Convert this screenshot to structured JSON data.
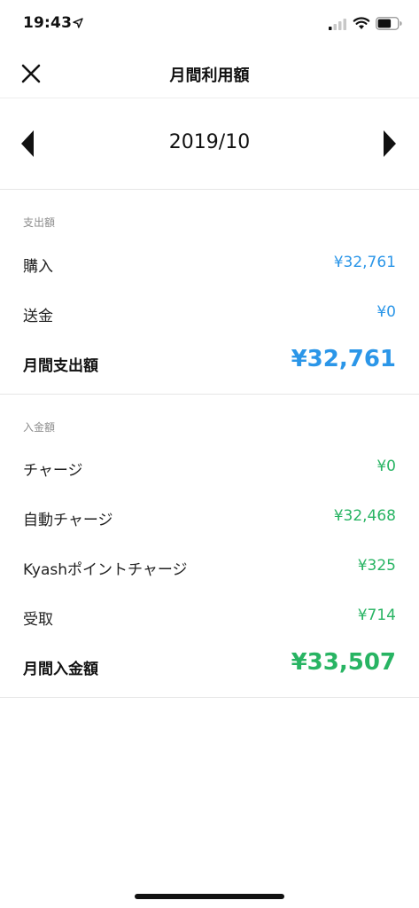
{
  "status_bar": {
    "time": "19:43",
    "icons": [
      "location-icon",
      "signal-icon",
      "wifi-icon",
      "battery-icon"
    ]
  },
  "nav": {
    "title": "月間利用額",
    "close_icon": "close-icon"
  },
  "month_selector": {
    "month": "2019/10",
    "prev_icon": "triangle-left-icon",
    "next_icon": "triangle-right-icon"
  },
  "expense": {
    "header": "支出額",
    "rows": [
      {
        "label": "購入",
        "value": "¥32,761"
      },
      {
        "label": "送金",
        "value": "¥0"
      }
    ],
    "total": {
      "label": "月間支出額",
      "value": "¥32,761"
    },
    "color": "#2b96e8"
  },
  "income": {
    "header": "入金額",
    "rows": [
      {
        "label": "チャージ",
        "value": "¥0"
      },
      {
        "label": "自動チャージ",
        "value": "¥32,468"
      },
      {
        "label": "Kyashポイントチャージ",
        "value": "¥325"
      },
      {
        "label": "受取",
        "value": "¥714"
      }
    ],
    "total": {
      "label": "月間入金額",
      "value": "¥33,507"
    },
    "color": "#28b463"
  }
}
